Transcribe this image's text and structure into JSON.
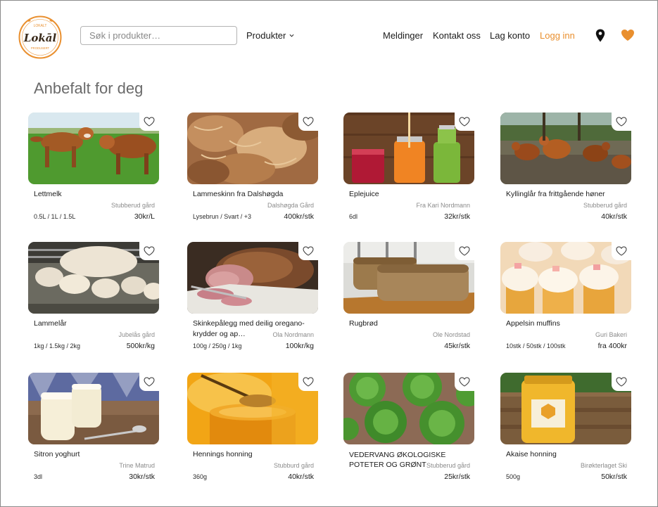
{
  "header": {
    "logo": {
      "top_text": "LOKALT",
      "main_text": "Lokāl",
      "bottom_text": "PRODUSERT",
      "color": "#e98f2e"
    },
    "search_placeholder": "Søk i produkter…",
    "products_menu_label": "Produkter",
    "nav": {
      "messages": "Meldinger",
      "contact": "Kontakt oss",
      "create_account": "Lag konto",
      "login": "Logg inn"
    },
    "icons": [
      "location-pin-icon",
      "heart-icon"
    ],
    "accent_color": "#e98f2e"
  },
  "section_title": "Anbefalt for deg",
  "products": [
    {
      "name": "Lettmelk",
      "seller": "Stubberud gård",
      "variants": "0.5L / 1L / 1.5L",
      "price": "30kr/L",
      "image": "cows"
    },
    {
      "name": "Lammeskinn fra Dalshøgda",
      "seller": "Dalshøgda Gård",
      "variants": "Lysebrun / Svart / +3",
      "price": "400kr/stk",
      "image": "sheepskin"
    },
    {
      "name": "Eplejuice",
      "seller": "Fra Kari Nordmann",
      "variants": "6dl",
      "price": "32kr/stk",
      "image": "juice"
    },
    {
      "name": "Kyllinglår fra frittgående høner",
      "seller": "Stubberud gård",
      "variants": "",
      "price": "40kr/stk",
      "image": "chickens"
    },
    {
      "name": "Lammelår",
      "seller": "Jubelås gård",
      "variants": "1kg / 1.5kg / 2kg",
      "price": "500kr/kg",
      "image": "lambs"
    },
    {
      "name": "Skinkepålegg med deilig oregano-krydder og ap…",
      "seller": "Ola Nordmann",
      "variants": "100g / 250g / 1kg",
      "price": "100kr/kg",
      "image": "ham"
    },
    {
      "name": "Rugbrød",
      "seller": "Ole Nordstad",
      "variants": "",
      "price": "45kr/stk",
      "image": "bread"
    },
    {
      "name": "Appelsin muffins",
      "seller": "Guri Bakeri",
      "variants": "10stk / 50stk / 100stk",
      "price": "fra 400kr",
      "image": "muffins"
    },
    {
      "name": "Sitron yoghurt",
      "seller": "Trine Matrud",
      "variants": "3dl",
      "price": "30kr/stk",
      "image": "yoghurt"
    },
    {
      "name": "Hennings honning",
      "seller": "Stubburd gård",
      "variants": "360g",
      "price": "40kr/stk",
      "image": "honey-spoon"
    },
    {
      "name": "VEDERVANG ØKOLOGISKE POTETER OG GRØNT",
      "seller": "Stubberud gård",
      "variants": "",
      "price": "25kr/stk",
      "image": "lettuce"
    },
    {
      "name": "Akaise honning",
      "seller": "Birøkterlaget Ski",
      "variants": "500g",
      "price": "50kr/stk",
      "image": "honey-jar"
    }
  ]
}
